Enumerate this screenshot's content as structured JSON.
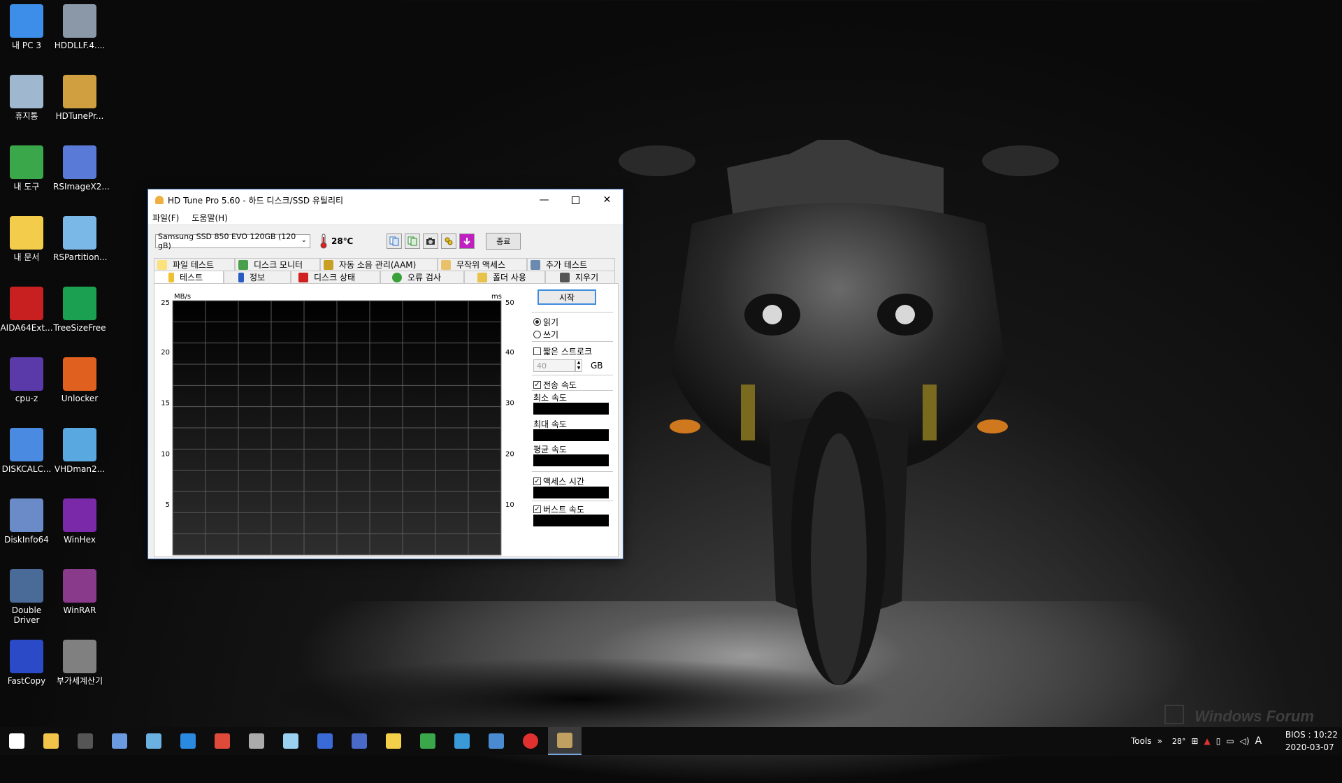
{
  "desktop": {
    "icons": [
      {
        "label": "내 PC 3",
        "icon": "computer-icon"
      },
      {
        "label": "HDDLLF.4....",
        "icon": "hdd-icon"
      },
      {
        "label": "휴지통",
        "icon": "recycle-bin-icon"
      },
      {
        "label": "HDTunePr...",
        "icon": "hdtune-icon"
      },
      {
        "label": "내 도구",
        "icon": "tools-icon"
      },
      {
        "label": "RSImageX2...",
        "icon": "rsimage-icon"
      },
      {
        "label": "내 문서",
        "icon": "documents-folder-icon"
      },
      {
        "label": "RSPartition...",
        "icon": "rspartition-icon"
      },
      {
        "label": "AIDA64Ext...",
        "icon": "aida64-icon"
      },
      {
        "label": "TreeSizeFree",
        "icon": "treesize-icon"
      },
      {
        "label": "cpu-z",
        "icon": "cpuz-icon"
      },
      {
        "label": "Unlocker",
        "icon": "unlocker-icon"
      },
      {
        "label": "DISKCALC...",
        "icon": "diskcalc-icon"
      },
      {
        "label": "VHDman2...",
        "icon": "vhdman-icon"
      },
      {
        "label": "DiskInfo64",
        "icon": "diskinfo-icon"
      },
      {
        "label": "WinHex",
        "icon": "winhex-icon"
      },
      {
        "label": "Double Driver",
        "icon": "double-driver-icon"
      },
      {
        "label": "WinRAR",
        "icon": "winrar-icon"
      },
      {
        "label": "FastCopy",
        "icon": "fastcopy-icon"
      },
      {
        "label": "부가세계산기",
        "icon": "calculator-icon"
      }
    ],
    "watermark": "Windows Forum"
  },
  "window": {
    "title": "HD Tune Pro 5.60 - 하드 디스크/SSD 유틸리티",
    "menu": [
      "파일(F)",
      "도움말(H)"
    ],
    "drive": "Samsung SSD 850 EVO 120GB (120 gB)",
    "temperature": "28℃",
    "exit_label": "종료",
    "tabs_top": [
      "파일 테스트",
      "디스크 모니터",
      "자동 소음 관리(AAM)",
      "무작위 액세스",
      "추가 테스트"
    ],
    "tabs_bottom": [
      "테스트",
      "정보",
      "디스크 상태",
      "오류 검사",
      "폴더 사용",
      "지우기"
    ],
    "active_tab": "테스트",
    "controls": {
      "start_label": "시작",
      "read_label": "읽기",
      "write_label": "쓰기",
      "short_stroke_label": "짧은 스트로크",
      "short_stroke_value": "40",
      "short_stroke_unit": "GB",
      "transfer_rate_label": "전송 속도",
      "min_label": "최소 속도",
      "max_label": "최대 속도",
      "avg_label": "평균 속도",
      "access_time_label": "액세스 시간",
      "burst_label": "버스트 속도",
      "read_selected": true,
      "short_stroke_checked": false,
      "transfer_checked": true,
      "access_checked": true,
      "burst_checked": true
    }
  },
  "chart_data": {
    "type": "line",
    "ylabel": "MB/s",
    "y2label": "ms",
    "yticks": [
      "25",
      "20",
      "15",
      "10",
      "5"
    ],
    "y2ticks": [
      "50",
      "40",
      "30",
      "20",
      "10"
    ],
    "ylim": [
      0,
      25
    ],
    "y2lim": [
      0,
      50
    ],
    "series": [],
    "grid": true
  },
  "taskbar": {
    "apps": [
      "start-icon",
      "file-explorer-icon",
      "cmd-icon",
      "desktop-icon",
      "monitor-icon",
      "edge-icon",
      "chrome-icon",
      "drive-icon",
      "notepad-icon",
      "grid-app-icon",
      "floppy-icon",
      "docs-icon",
      "calc-icon",
      "network-app-icon",
      "folder-app-icon",
      "power-icon",
      "hdtune-taskbar-icon"
    ],
    "tools_label": "Tools",
    "temp": "28°",
    "ime": "A",
    "bios": "BIOS : 10:22",
    "date": "2020-03-07"
  }
}
